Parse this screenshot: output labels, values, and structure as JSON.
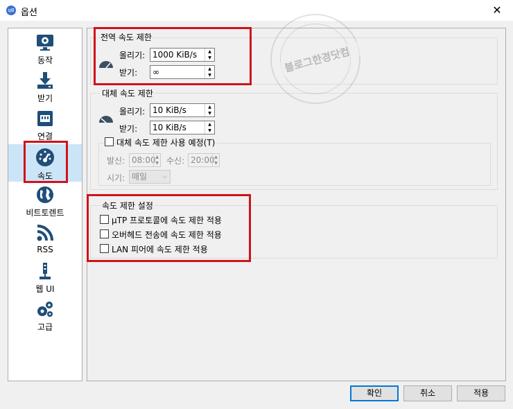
{
  "window": {
    "title": "옵션",
    "app_icon": "qB"
  },
  "sidebar": {
    "items": [
      {
        "label": "동작",
        "icon": "monitor-gear-icon"
      },
      {
        "label": "받기",
        "icon": "download-icon"
      },
      {
        "label": "연결",
        "icon": "network-icon"
      },
      {
        "label": "속도",
        "icon": "speedometer-icon"
      },
      {
        "label": "비트토렌트",
        "icon": "globe-icon"
      },
      {
        "label": "RSS",
        "icon": "rss-icon"
      },
      {
        "label": "웹 UI",
        "icon": "usb-icon"
      },
      {
        "label": "고급",
        "icon": "gears-icon"
      }
    ],
    "selected": "속도"
  },
  "global_limits": {
    "title": "전역 속도 제한",
    "upload_label": "올리기:",
    "upload_value": "1000 KiB/s",
    "download_label": "받기:",
    "download_value": "∞"
  },
  "alt_limits": {
    "title": "대체 속도 제한",
    "upload_label": "올리기:",
    "upload_value": "10 KiB/s",
    "download_label": "받기:",
    "download_value": "10 KiB/s",
    "schedule_checkbox": "대체 속도 제한 사용 예정(T)",
    "from_label": "발신:",
    "from_value": "08:00",
    "to_label": "수신:",
    "to_value": "20:00",
    "when_label": "시기:",
    "when_value": "매일"
  },
  "rate_settings": {
    "title": "속도 제한 설정",
    "options": [
      "µTP 프로토콜에 속도 제한 적용",
      "오버헤드 전송에 속도 제한 적용",
      "LAN 피어에 속도 제한 적용"
    ]
  },
  "buttons": {
    "ok": "확인",
    "cancel": "취소",
    "apply": "적용"
  },
  "watermark": {
    "text": "블로그한경닷컴"
  },
  "colors": {
    "highlight": "#d0121a",
    "accent": "#0078d7",
    "icon": "#1f4e79"
  }
}
